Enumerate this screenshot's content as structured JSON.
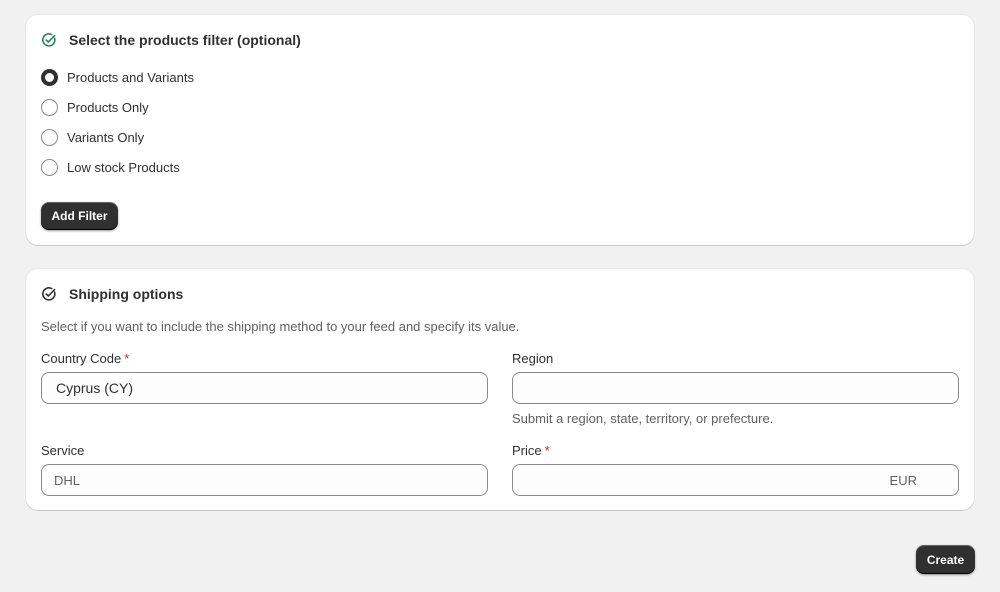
{
  "filter_card": {
    "title": "Select the products filter (optional)",
    "options": [
      {
        "label": "Products and Variants",
        "checked": true
      },
      {
        "label": "Products Only",
        "checked": false
      },
      {
        "label": "Variants Only",
        "checked": false
      },
      {
        "label": "Low stock Products",
        "checked": false
      }
    ],
    "add_filter_label": "Add Filter"
  },
  "shipping_card": {
    "title": "Shipping options",
    "description": "Select if you want to include the shipping method to your feed and specify its value.",
    "country": {
      "label": "Country Code",
      "required_mark": "*",
      "value": "Cyprus (CY)"
    },
    "region": {
      "label": "Region",
      "value": "",
      "help": "Submit a region, state, territory, or prefecture."
    },
    "service": {
      "label": "Service",
      "placeholder": "DHL"
    },
    "price": {
      "label": "Price",
      "required_mark": "*",
      "value": "",
      "suffix": "EUR"
    }
  },
  "footer": {
    "create_label": "Create"
  },
  "colors": {
    "accent_check": "#29845a",
    "primary_button": "#303030",
    "required": "#c5280c"
  },
  "icons": {
    "title_icon": "check-circle-icon"
  }
}
